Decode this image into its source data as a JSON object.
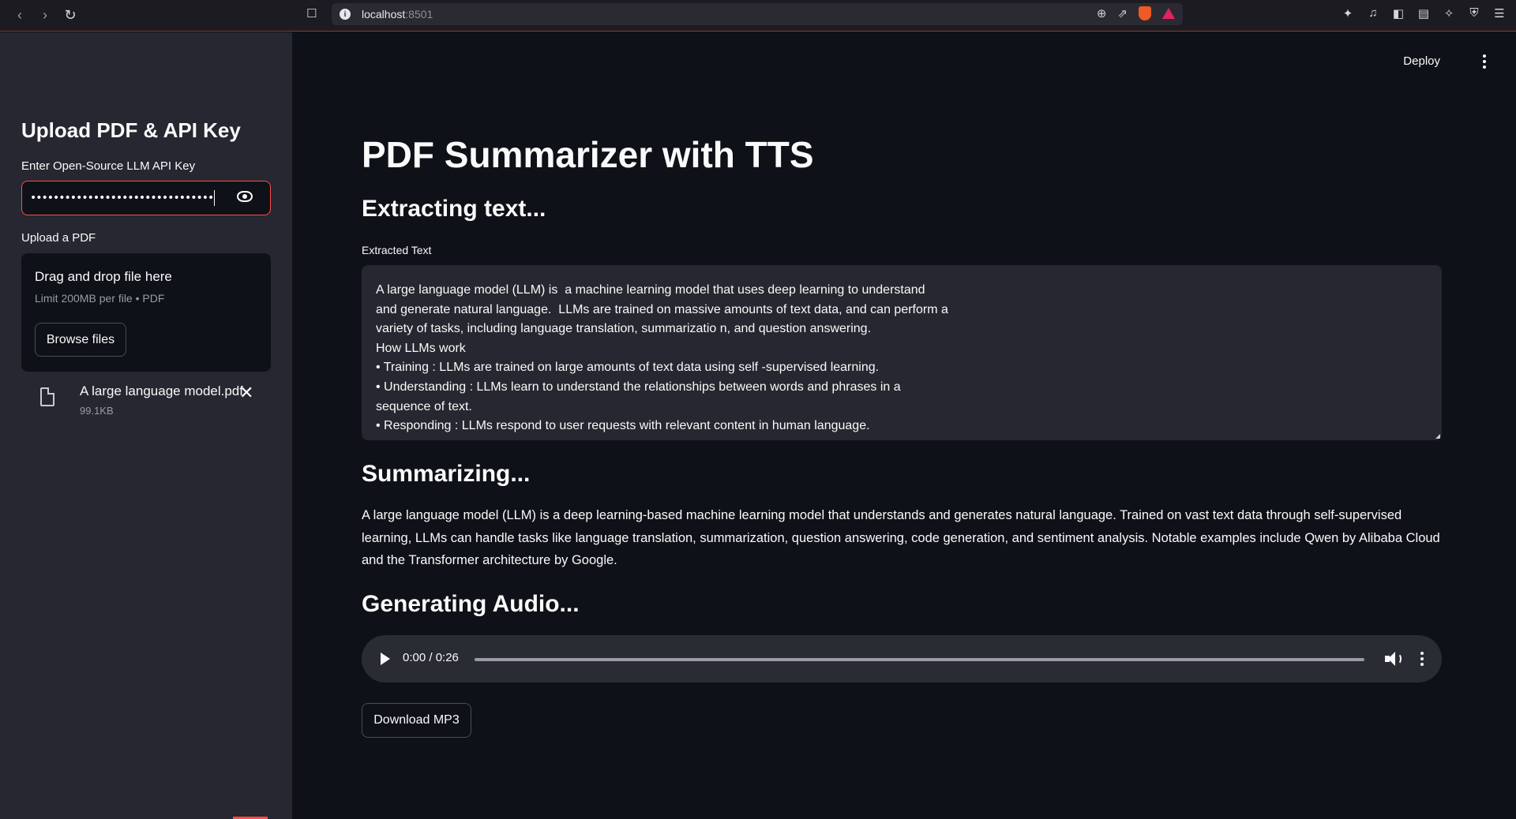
{
  "browser": {
    "url_host": "localhost",
    "url_port": ":8501"
  },
  "sidebar": {
    "heading": "Upload PDF & API Key",
    "api_key_label": "Enter Open-Source LLM API Key",
    "api_key_masked": "••••••••••••••••••••••••••••••••",
    "upload_label": "Upload a PDF",
    "dropzone_title": "Drag and drop file here",
    "dropzone_limit": "Limit 200MB per file • PDF",
    "browse_label": "Browse files",
    "file": {
      "name": "A large language model.pdf",
      "size": "99.1KB"
    }
  },
  "header": {
    "deploy_label": "Deploy"
  },
  "main": {
    "title": "PDF Summarizer with TTS",
    "extract_heading": "Extracting text...",
    "extracted_label": "Extracted Text",
    "extracted_lines": [
      "A large language model (LLM) is  a machine learning model that uses deep learning to understand",
      "and generate natural language.  LLMs are trained on massive amounts of text data, and can perform a",
      "variety of tasks, including language translation, summarizatio n, and question answering.",
      "How LLMs work",
      "• Training : LLMs are trained on large amounts of text data using self -supervised learning.",
      "• Understanding : LLMs learn to understand the relationships between words and phrases in a",
      "sequence of text.",
      "• Responding : LLMs respond to user requests with relevant content in human language."
    ],
    "summarize_heading": "Summarizing...",
    "summary": "A large language model (LLM) is a deep learning-based machine learning model that understands and generates natural language. Trained on vast text data through self-supervised learning, LLMs can handle tasks like language translation, summarization, question answering, code generation, and sentiment analysis. Notable examples include Qwen by Alibaba Cloud and the Transformer architecture by Google.",
    "audio_heading": "Generating Audio...",
    "audio_time": "0:00 / 0:26",
    "audio_progress": 0,
    "download_label": "Download MP3"
  },
  "icons": [
    "back-icon",
    "forward-icon",
    "reload-icon",
    "bookmark-icon",
    "info-icon",
    "zoom-icon",
    "share-icon",
    "brave-shield-icon",
    "brave-rewards-icon",
    "extensions-icon",
    "music-icon",
    "sidebar-icon",
    "wallet-icon",
    "leo-icon",
    "vpn-icon",
    "menu-icon",
    "eye-icon",
    "file-icon",
    "close-icon",
    "kebab-icon",
    "play-icon",
    "volume-icon"
  ],
  "colors": {
    "accent": "#ff4b4b",
    "sidebar_bg": "#262730",
    "main_bg": "#0e1117"
  }
}
